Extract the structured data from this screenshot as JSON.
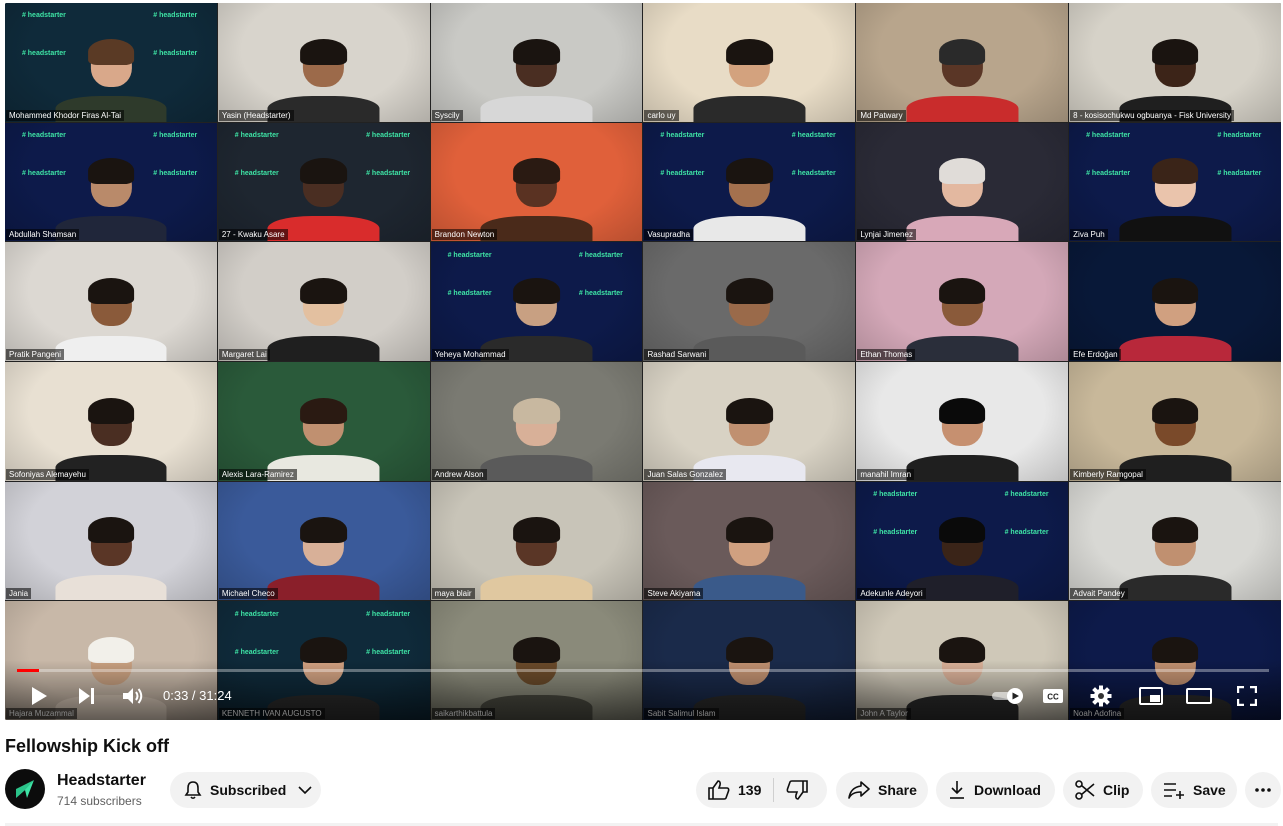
{
  "player": {
    "participants": [
      {
        "name": "Mohammed Khodor Firas Al-Tai",
        "bg": "#0f2a3a",
        "skin": "#d9a88a",
        "hair": "#5a3a25",
        "shirt": "#2e3a2b",
        "brand": true
      },
      {
        "name": "Yasin (Headstarter)",
        "bg": "#d8d4cc",
        "skin": "#9c6a4a",
        "hair": "#1a1410",
        "shirt": "#2a2a2a",
        "brand": false
      },
      {
        "name": "Syscily",
        "bg": "#c9c9c5",
        "skin": "#4a2e22",
        "hair": "#1a1410",
        "shirt": "#d7d7d7",
        "brand": false
      },
      {
        "name": "carlo uy",
        "bg": "#e8dcc6",
        "skin": "#d3a27e",
        "hair": "#1a1410",
        "shirt": "#2a2a2a",
        "brand": false
      },
      {
        "name": "Md Patwary",
        "bg": "#b8a58c",
        "skin": "#5a3626",
        "hair": "#2a2a2a",
        "shirt": "#c92c2c",
        "brand": false
      },
      {
        "name": "8 - kosisochukwu ogbuanya - Fisk University",
        "bg": "#d6d2c8",
        "skin": "#3c2418",
        "hair": "#1a1410",
        "shirt": "#1f1f1f",
        "brand": false
      },
      {
        "name": "Abdullah Shamsan",
        "bg": "#0d1a4a",
        "skin": "#b98a6a",
        "hair": "#1a1410",
        "shirt": "#20263a",
        "brand": true
      },
      {
        "name": "27 - Kwaku Asare",
        "bg": "#1e2630",
        "skin": "#4a2e22",
        "hair": "#1a1410",
        "shirt": "#d92c2c",
        "brand": true
      },
      {
        "name": "Brandon Newton",
        "bg": "#e0603a",
        "skin": "#5a3222",
        "hair": "#2a1a12",
        "shirt": "#4a2a1a",
        "brand": false
      },
      {
        "name": "Vasupradha",
        "bg": "#0d1a4a",
        "skin": "#a4714e",
        "hair": "#1a1410",
        "shirt": "#e8e8e8",
        "brand": true
      },
      {
        "name": "Lynjai Jimenez",
        "bg": "#2a2a36",
        "skin": "#e3b8a0",
        "hair": "#e0dcd8",
        "shirt": "#d8a8b8",
        "brand": false
      },
      {
        "name": "Ziva Puh",
        "bg": "#0d1a4a",
        "skin": "#eac4ac",
        "hair": "#3a2418",
        "shirt": "#111111",
        "brand": true
      },
      {
        "name": "Pratik Pangeni",
        "bg": "#dcd8d2",
        "skin": "#8a5a3a",
        "hair": "#1a1410",
        "shirt": "#efefef",
        "brand": false
      },
      {
        "name": "Margaret Lai",
        "bg": "#d2cec8",
        "skin": "#e3c0a0",
        "hair": "#1a1410",
        "shirt": "#1f1f1f",
        "brand": false
      },
      {
        "name": "Yeheya Mohammad",
        "bg": "#0d1a4a",
        "skin": "#c8a082",
        "hair": "#1a1410",
        "shirt": "#2a2a2a",
        "brand": true
      },
      {
        "name": "Rashad Sarwani",
        "bg": "#6a6a6a",
        "skin": "#9a6a4a",
        "hair": "#1a1410",
        "shirt": "#5a5a5a",
        "brand": false
      },
      {
        "name": "Ethan Thomas",
        "bg": "#d4a8b8",
        "skin": "#8a5a3a",
        "hair": "#1a1410",
        "shirt": "#2a2e3a",
        "brand": false
      },
      {
        "name": "Efe Erdoğan",
        "bg": "#081838",
        "skin": "#d0a080",
        "hair": "#1a1410",
        "shirt": "#b8283a",
        "brand": false
      },
      {
        "name": "Sofoniyas Alemayehu",
        "bg": "#e8e0d2",
        "skin": "#4a2e22",
        "hair": "#1a1410",
        "shirt": "#222222",
        "brand": false
      },
      {
        "name": "Alexis Lara-Ramirez",
        "bg": "#2a5a3a",
        "skin": "#c09070",
        "hair": "#2a1a12",
        "shirt": "#e8e8e0",
        "brand": false
      },
      {
        "name": "Andrew Alson",
        "bg": "#7a7a72",
        "skin": "#d8b098",
        "hair": "#c8b8a0",
        "shirt": "#5a5a5a",
        "brand": false
      },
      {
        "name": "Juan Salas Gonzalez",
        "bg": "#d8d2c4",
        "skin": "#c09070",
        "hair": "#1a1410",
        "shirt": "#e8e8f0",
        "brand": false
      },
      {
        "name": "manahil Imran",
        "bg": "#e8e8e8",
        "skin": "#c69070",
        "hair": "#0a0a0a",
        "shirt": "#1f1f1f",
        "brand": false
      },
      {
        "name": "Kimberly Ramgopal",
        "bg": "#c8b89a",
        "skin": "#7a4a2a",
        "hair": "#1a1410",
        "shirt": "#1f1f1f",
        "brand": false
      },
      {
        "name": "Jania",
        "bg": "#d2d2d8",
        "skin": "#5a3626",
        "hair": "#1a1410",
        "shirt": "#e8e0d8",
        "brand": false
      },
      {
        "name": "Michael Checo",
        "bg": "#3a5a9a",
        "skin": "#d8b098",
        "hair": "#1a1410",
        "shirt": "#8a1f2a",
        "brand": false
      },
      {
        "name": "maya blair",
        "bg": "#c8c4b8",
        "skin": "#5a3626",
        "hair": "#1a1410",
        "shirt": "#e0c8a0",
        "brand": false
      },
      {
        "name": "Steve Akiyama",
        "bg": "#6a5a5a",
        "skin": "#d0a080",
        "hair": "#1a1410",
        "shirt": "#3a5a8a",
        "brand": false
      },
      {
        "name": "Adekunle Adeyori",
        "bg": "#0d1a4a",
        "skin": "#3a2418",
        "hair": "#0a0a0a",
        "shirt": "#1f1f2a",
        "brand": true
      },
      {
        "name": "Advait Pandey",
        "bg": "#d8d8d4",
        "skin": "#c09070",
        "hair": "#1a1410",
        "shirt": "#2a2a2a",
        "brand": false
      },
      {
        "name": "Hajara Muzammal",
        "bg": "#c8b8a8",
        "skin": "#c8a080",
        "hair": "#f2f0ea",
        "shirt": "#d8c8b8",
        "brand": false
      },
      {
        "name": "KENNETH IVAN AUGUSTO",
        "bg": "#0f2a3a",
        "skin": "#d0a080",
        "hair": "#1a1410",
        "shirt": "#2a2a2a",
        "brand": true
      },
      {
        "name": "saikarthikbattula",
        "bg": "#8a8a7a",
        "skin": "#6a4a2a",
        "hair": "#1a1410",
        "shirt": "#4a4a40",
        "brand": false
      },
      {
        "name": "Sabit Salimul Islam",
        "bg": "#1a2a4a",
        "skin": "#c09070",
        "hair": "#1a1410",
        "shirt": "#2a2a2a",
        "brand": false
      },
      {
        "name": "John A Taylor",
        "bg": "#cfc8b8",
        "skin": "#d8b098",
        "hair": "#1a1410",
        "shirt": "#2a2a2a",
        "brand": false
      },
      {
        "name": "Noah Adofina",
        "bg": "#0d1a4a",
        "skin": "#c09070",
        "hair": "#1a1410",
        "shirt": "#2a2a2a",
        "brand": false
      }
    ],
    "brand_text": "# headstarter",
    "progress": 0.0176,
    "time": "0:33 / 31:24"
  },
  "video": {
    "title": "Fellowship Kick off"
  },
  "channel": {
    "name": "Headstarter",
    "subscribers": "714 subscribers",
    "subscribe_label": "Subscribed",
    "avatar_icon": "headstarter-logo-icon"
  },
  "actions": {
    "likes": "139",
    "share": "Share",
    "download": "Download",
    "clip": "Clip",
    "save": "Save"
  },
  "colors": {
    "progress": "#ff0000",
    "pill_bg": "#f2f2f2",
    "brand_green": "#3ee3a5"
  }
}
